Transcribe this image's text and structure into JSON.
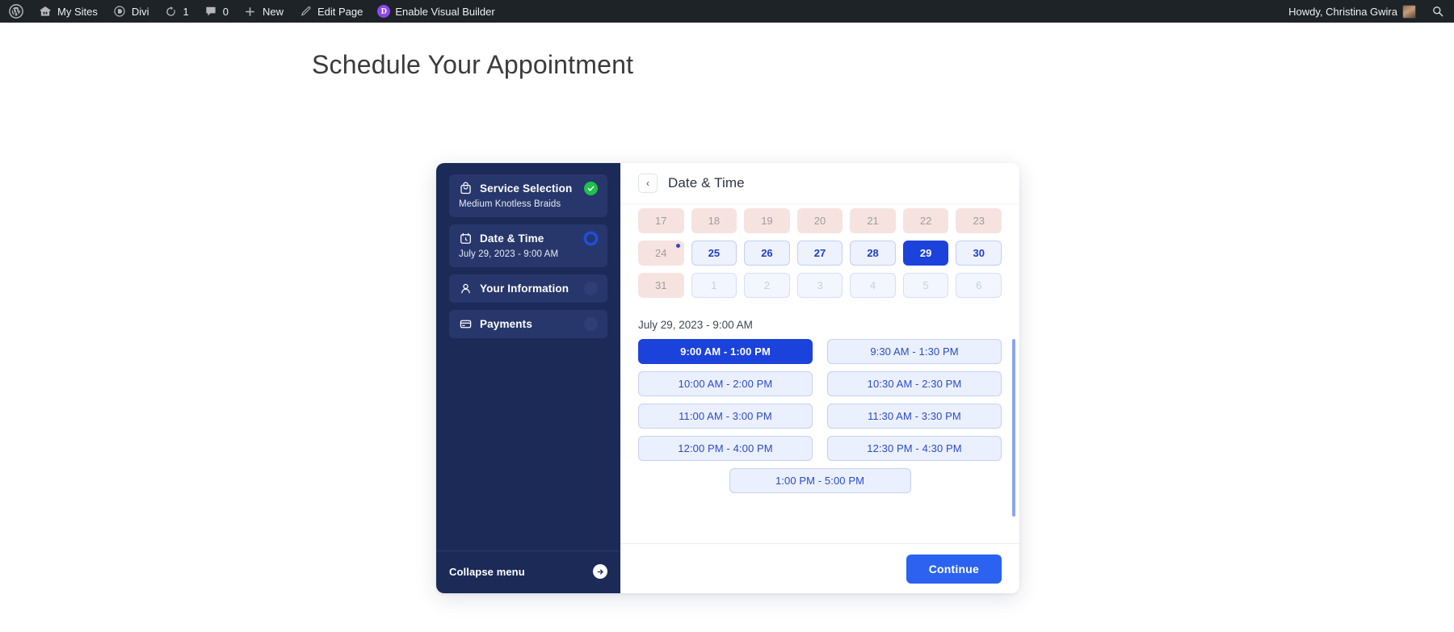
{
  "adminbar": {
    "items": [
      {
        "icon": "wordpress-logo-icon",
        "label": ""
      },
      {
        "icon": "my-sites-icon",
        "label": "My Sites"
      },
      {
        "icon": "divi-icon",
        "label": "Divi"
      },
      {
        "icon": "updates-icon",
        "label": "1"
      },
      {
        "icon": "comments-icon",
        "label": "0"
      },
      {
        "icon": "plus-icon",
        "label": "New"
      },
      {
        "icon": "pencil-icon",
        "label": "Edit Page"
      },
      {
        "icon": "divi-badge-icon",
        "label": "Enable Visual Builder"
      }
    ],
    "howdy": "Howdy, Christina Gwira",
    "search_icon": "search-icon",
    "divi_badge_letter": "D"
  },
  "page": {
    "title": "Schedule Your Appointment"
  },
  "booking": {
    "sidebar": {
      "steps": [
        {
          "icon": "bag-icon",
          "label": "Service Selection",
          "sub": "Medium Knotless Braids",
          "state": "done"
        },
        {
          "icon": "calendar-clock-icon",
          "label": "Date & Time",
          "sub": "July 29, 2023 - 9:00 AM",
          "state": "active"
        },
        {
          "icon": "person-icon",
          "label": "Your Information",
          "sub": "",
          "state": "idle"
        },
        {
          "icon": "card-icon",
          "label": "Payments",
          "sub": "",
          "state": "idle"
        }
      ],
      "collapse_label": "Collapse menu",
      "collapse_icon": "arrow-right-circle-icon"
    },
    "header": {
      "back_icon": "chevron-left-icon",
      "back_glyph": "‹",
      "title": "Date & Time"
    },
    "calendar": {
      "days": [
        {
          "n": "17",
          "state": "past"
        },
        {
          "n": "18",
          "state": "past"
        },
        {
          "n": "19",
          "state": "past"
        },
        {
          "n": "20",
          "state": "past"
        },
        {
          "n": "21",
          "state": "past"
        },
        {
          "n": "22",
          "state": "past"
        },
        {
          "n": "23",
          "state": "past"
        },
        {
          "n": "24",
          "state": "past",
          "dot": true
        },
        {
          "n": "25",
          "state": "avail"
        },
        {
          "n": "26",
          "state": "avail"
        },
        {
          "n": "27",
          "state": "avail"
        },
        {
          "n": "28",
          "state": "avail"
        },
        {
          "n": "29",
          "state": "sel"
        },
        {
          "n": "30",
          "state": "avail"
        },
        {
          "n": "31",
          "state": "past"
        },
        {
          "n": "1",
          "state": "next"
        },
        {
          "n": "2",
          "state": "next"
        },
        {
          "n": "3",
          "state": "next"
        },
        {
          "n": "4",
          "state": "next"
        },
        {
          "n": "5",
          "state": "next"
        },
        {
          "n": "6",
          "state": "next"
        }
      ]
    },
    "slots": {
      "caption": "July 29, 2023 - 9:00 AM",
      "items": [
        {
          "label": "9:00 AM - 1:00 PM",
          "selected": true
        },
        {
          "label": "9:30 AM - 1:30 PM",
          "selected": false
        },
        {
          "label": "10:00 AM - 2:00 PM",
          "selected": false
        },
        {
          "label": "10:30 AM - 2:30 PM",
          "selected": false
        },
        {
          "label": "11:00 AM - 3:00 PM",
          "selected": false
        },
        {
          "label": "11:30 AM - 3:30 PM",
          "selected": false
        },
        {
          "label": "12:00 PM - 4:00 PM",
          "selected": false
        },
        {
          "label": "12:30 PM - 4:30 PM",
          "selected": false
        },
        {
          "label": "1:00 PM - 5:00 PM",
          "selected": false
        }
      ]
    },
    "footer": {
      "continue_label": "Continue"
    }
  },
  "colors": {
    "admin_bar": "#1d2327",
    "sidebar": "#1c2a58",
    "accent_blue": "#1b42db",
    "continue_blue": "#2b62f0",
    "done_green": "#21bf4b",
    "past_day": "#f6e3df"
  }
}
